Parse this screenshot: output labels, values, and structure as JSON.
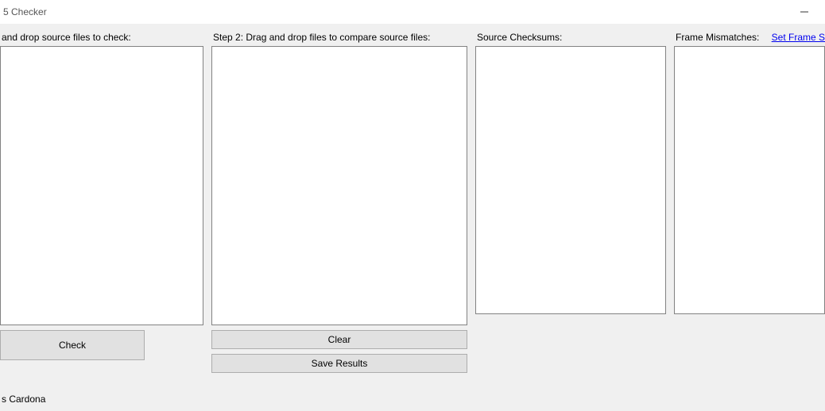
{
  "window": {
    "title": "5 Checker"
  },
  "labels": {
    "step1": "and drop source files to check:",
    "step2": "Step 2: Drag and drop files to compare source files:",
    "sourceChecksums": "Source Checksums:",
    "frameMismatches": "Frame Mismatches:"
  },
  "buttons": {
    "check": "Check",
    "clear": "Clear",
    "saveResults": "Save Results"
  },
  "links": {
    "setFrame": "Set Frame S"
  },
  "footer": {
    "credit": "s Cardona"
  }
}
